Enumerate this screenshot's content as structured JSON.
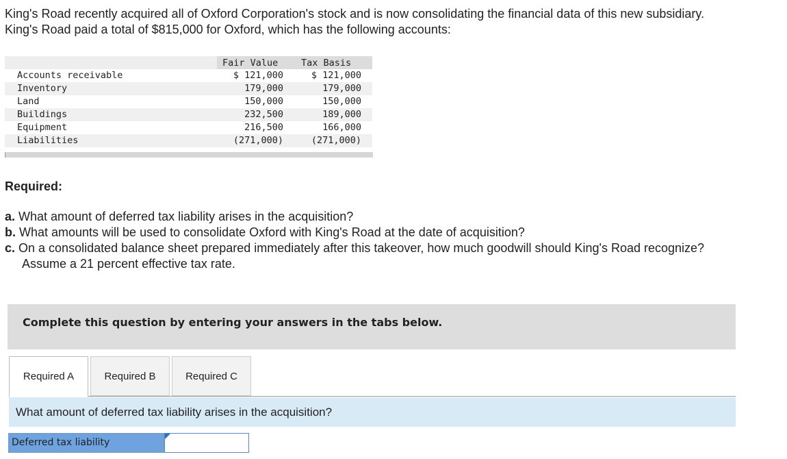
{
  "intro": {
    "line1": "King's Road recently acquired all of Oxford Corporation's stock and is now consolidating the financial data of this new subsidiary.",
    "line2": "King's Road paid a total of $815,000 for Oxford, which has the following accounts:"
  },
  "accounts": {
    "headers": {
      "fair_value": "Fair Value",
      "tax_basis": "Tax Basis"
    },
    "rows": [
      {
        "name": "Accounts receivable",
        "fair_value": "$ 121,000",
        "tax_basis": "$ 121,000"
      },
      {
        "name": "Inventory",
        "fair_value": "179,000",
        "tax_basis": "179,000"
      },
      {
        "name": "Land",
        "fair_value": "150,000",
        "tax_basis": "150,000"
      },
      {
        "name": "Buildings",
        "fair_value": "232,500",
        "tax_basis": "189,000"
      },
      {
        "name": "Equipment",
        "fair_value": "216,500",
        "tax_basis": "166,000"
      },
      {
        "name": "Liabilities",
        "fair_value": "(271,000)",
        "tax_basis": "(271,000)"
      }
    ]
  },
  "required": {
    "title": "Required:",
    "a_prefix": "a.",
    "a_text": " What amount of deferred tax liability arises in the acquisition?",
    "b_prefix": "b.",
    "b_text": " What amounts will be used to consolidate Oxford with King's Road at the date of acquisition?",
    "c_prefix": "c.",
    "c_text": " On a consolidated balance sheet prepared immediately after this takeover, how much goodwill should King's Road recognize?",
    "c_continuation": "Assume a 21 percent effective tax rate."
  },
  "banner": {
    "text": "Complete this question by entering your answers in the tabs below."
  },
  "tabs": [
    {
      "label": "Required A",
      "active": true
    },
    {
      "label": "Required B",
      "active": false
    },
    {
      "label": "Required C",
      "active": false
    }
  ],
  "question_bar": {
    "text": "What amount of deferred tax liability arises in the acquisition?"
  },
  "answer": {
    "label": "Deferred tax liability",
    "value": ""
  },
  "colors": {
    "question_bar_bg": "#d9eaf7",
    "answer_label_bg": "#6fa3e0",
    "banner_bg": "#dddddd"
  }
}
